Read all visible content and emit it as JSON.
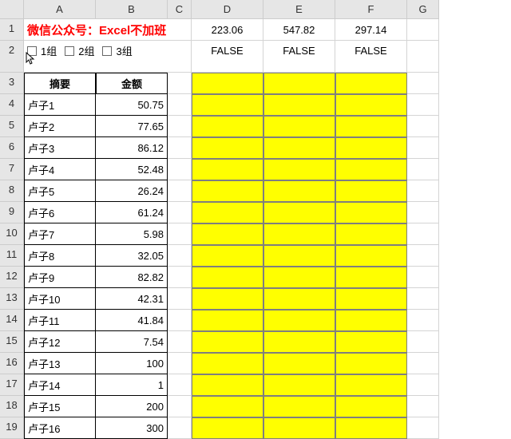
{
  "columns": [
    "A",
    "B",
    "C",
    "D",
    "E",
    "F",
    "G"
  ],
  "title": "微信公众号：Excel不加班",
  "checkboxes": {
    "g1": "1组",
    "g2": "2组",
    "g3": "3组"
  },
  "row1": {
    "d": "223.06",
    "e": "547.82",
    "f": "297.14"
  },
  "row2": {
    "d": "FALSE",
    "e": "FALSE",
    "f": "FALSE"
  },
  "table_headers": {
    "a": "摘要",
    "b": "金额"
  },
  "rows": [
    {
      "n": "4",
      "a": "卢子1",
      "b": "50.75"
    },
    {
      "n": "5",
      "a": "卢子2",
      "b": "77.65"
    },
    {
      "n": "6",
      "a": "卢子3",
      "b": "86.12"
    },
    {
      "n": "7",
      "a": "卢子4",
      "b": "52.48"
    },
    {
      "n": "8",
      "a": "卢子5",
      "b": "26.24"
    },
    {
      "n": "9",
      "a": "卢子6",
      "b": "61.24"
    },
    {
      "n": "10",
      "a": "卢子7",
      "b": "5.98"
    },
    {
      "n": "11",
      "a": "卢子8",
      "b": "32.05"
    },
    {
      "n": "12",
      "a": "卢子9",
      "b": "82.82"
    },
    {
      "n": "13",
      "a": "卢子10",
      "b": "42.31"
    },
    {
      "n": "14",
      "a": "卢子11",
      "b": "41.84"
    },
    {
      "n": "15",
      "a": "卢子12",
      "b": "7.54"
    },
    {
      "n": "16",
      "a": "卢子13",
      "b": "100"
    },
    {
      "n": "17",
      "a": "卢子14",
      "b": "1"
    },
    {
      "n": "18",
      "a": "卢子15",
      "b": "200"
    },
    {
      "n": "19",
      "a": "卢子16",
      "b": "300"
    }
  ],
  "chart_data": {
    "type": "table",
    "title": "微信公众号：Excel不加班",
    "sums": {
      "D": 223.06,
      "E": 547.82,
      "F": 297.14
    },
    "checkbox_links": {
      "D": "FALSE",
      "E": "FALSE",
      "F": "FALSE"
    },
    "columns": [
      "摘要",
      "金额"
    ],
    "data": [
      [
        "卢子1",
        50.75
      ],
      [
        "卢子2",
        77.65
      ],
      [
        "卢子3",
        86.12
      ],
      [
        "卢子4",
        52.48
      ],
      [
        "卢子5",
        26.24
      ],
      [
        "卢子6",
        61.24
      ],
      [
        "卢子7",
        5.98
      ],
      [
        "卢子8",
        32.05
      ],
      [
        "卢子9",
        82.82
      ],
      [
        "卢子10",
        42.31
      ],
      [
        "卢子11",
        41.84
      ],
      [
        "卢子12",
        7.54
      ],
      [
        "卢子13",
        100
      ],
      [
        "卢子14",
        1
      ],
      [
        "卢子15",
        200
      ],
      [
        "卢子16",
        300
      ]
    ]
  }
}
